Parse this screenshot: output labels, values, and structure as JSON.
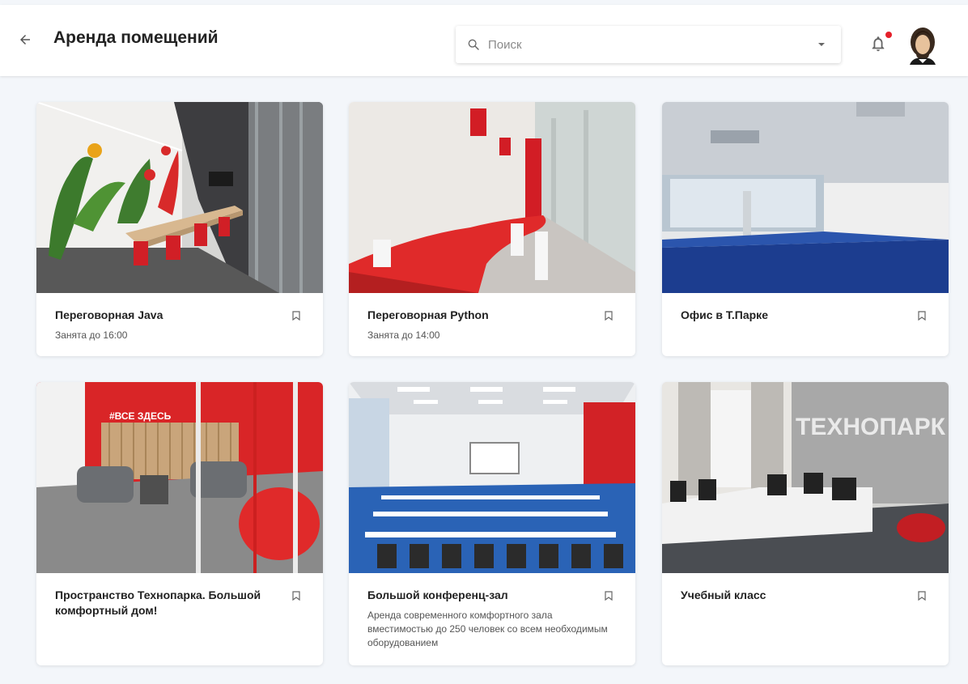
{
  "header": {
    "title": "Аренда помещений",
    "search": {
      "placeholder": "Поиск",
      "value": ""
    },
    "notification_dot_color": "#e5202a"
  },
  "icons": {
    "back": "arrow-left-icon",
    "search": "search-icon",
    "dropdown": "caret-down-icon",
    "notifications": "bell-icon",
    "bookmark": "bookmark-icon"
  },
  "rooms": [
    {
      "title": "Переговорная Java",
      "subtitle": "Занята до 16:00"
    },
    {
      "title": "Переговорная Python",
      "subtitle": "Занята до 14:00"
    },
    {
      "title": "Офис в Т.Парке",
      "subtitle": ""
    },
    {
      "title": "Пространство Технопарка. Большой комфортный дом!",
      "subtitle": ""
    },
    {
      "title": "Большой конференц-зал",
      "subtitle": "Аренда современного комфортного зала вместимостью до 250 человек со всем необходимым оборудованием"
    },
    {
      "title": "Учебный класс",
      "subtitle": ""
    }
  ],
  "photo_text": {
    "lounge_sign": "#ВСЕ ЗДЕСЬ",
    "classroom_wall": "ТЕХНОПАРК"
  }
}
